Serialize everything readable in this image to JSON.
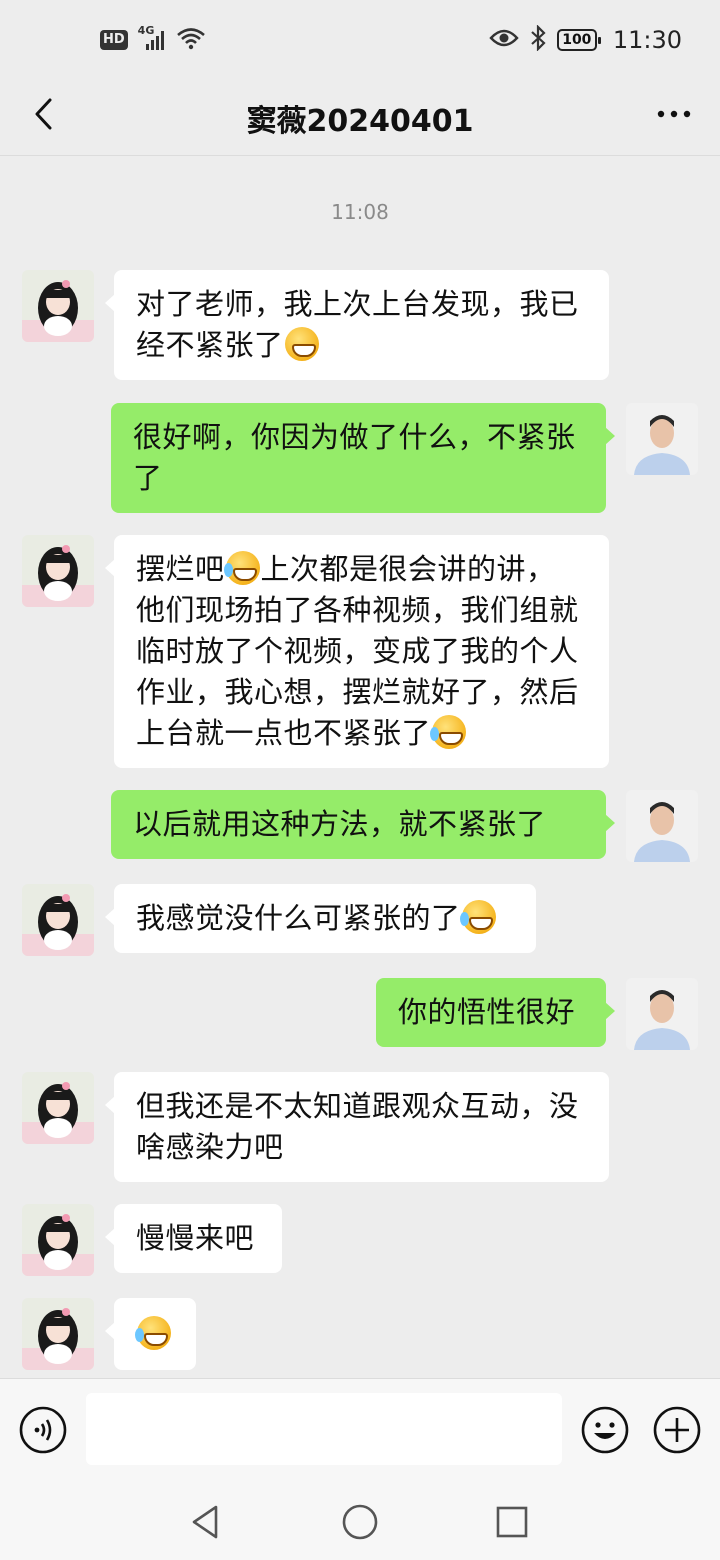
{
  "status_bar": {
    "hd": "HD",
    "network": "4G",
    "battery": "100",
    "time": "11:30"
  },
  "header": {
    "title": "窦薇20240401",
    "back_icon": "chevron-left-icon",
    "more_icon": "more-dots-icon"
  },
  "conversation": {
    "timestamp": "11:08",
    "messages": [
      {
        "side": "left",
        "lines": [
          "对了老师，我上次上台发现，我已",
          "经不紧张了"
        ],
        "emoji": "grin"
      },
      {
        "side": "right",
        "lines": [
          "很好啊，你因为做了什么，不紧张",
          "了"
        ]
      },
      {
        "side": "left",
        "lines": [
          "摆烂吧",
          "上次都是很会讲的讲，",
          "他们现场拍了各种视频，我们组就",
          "临时放了个视频，变成了我的个人",
          "作业，我心想，摆烂就好了，然后",
          "上台就一点也不紧张了"
        ]
      },
      {
        "side": "right",
        "lines": [
          "以后就用这种方法，就不紧张了"
        ]
      },
      {
        "side": "left",
        "lines": [
          "我感觉没什么可紧张的了"
        ]
      },
      {
        "side": "right",
        "lines": [
          "你的悟性很好"
        ]
      },
      {
        "side": "left",
        "lines": [
          "但我还是不太知道跟观众互动，没",
          "啥感染力吧"
        ]
      },
      {
        "side": "left",
        "lines": [
          "慢慢来吧"
        ]
      },
      {
        "side": "left",
        "lines": [
          ""
        ],
        "emoji_only": "cry-laugh"
      }
    ]
  },
  "input_bar": {
    "voice_icon": "voice-icon",
    "emoji_icon": "emoji-icon",
    "plus_icon": "plus-icon"
  },
  "system_nav": {
    "back_icon": "triangle-back-icon",
    "home_icon": "circle-home-icon",
    "recents_icon": "square-recents-icon"
  }
}
